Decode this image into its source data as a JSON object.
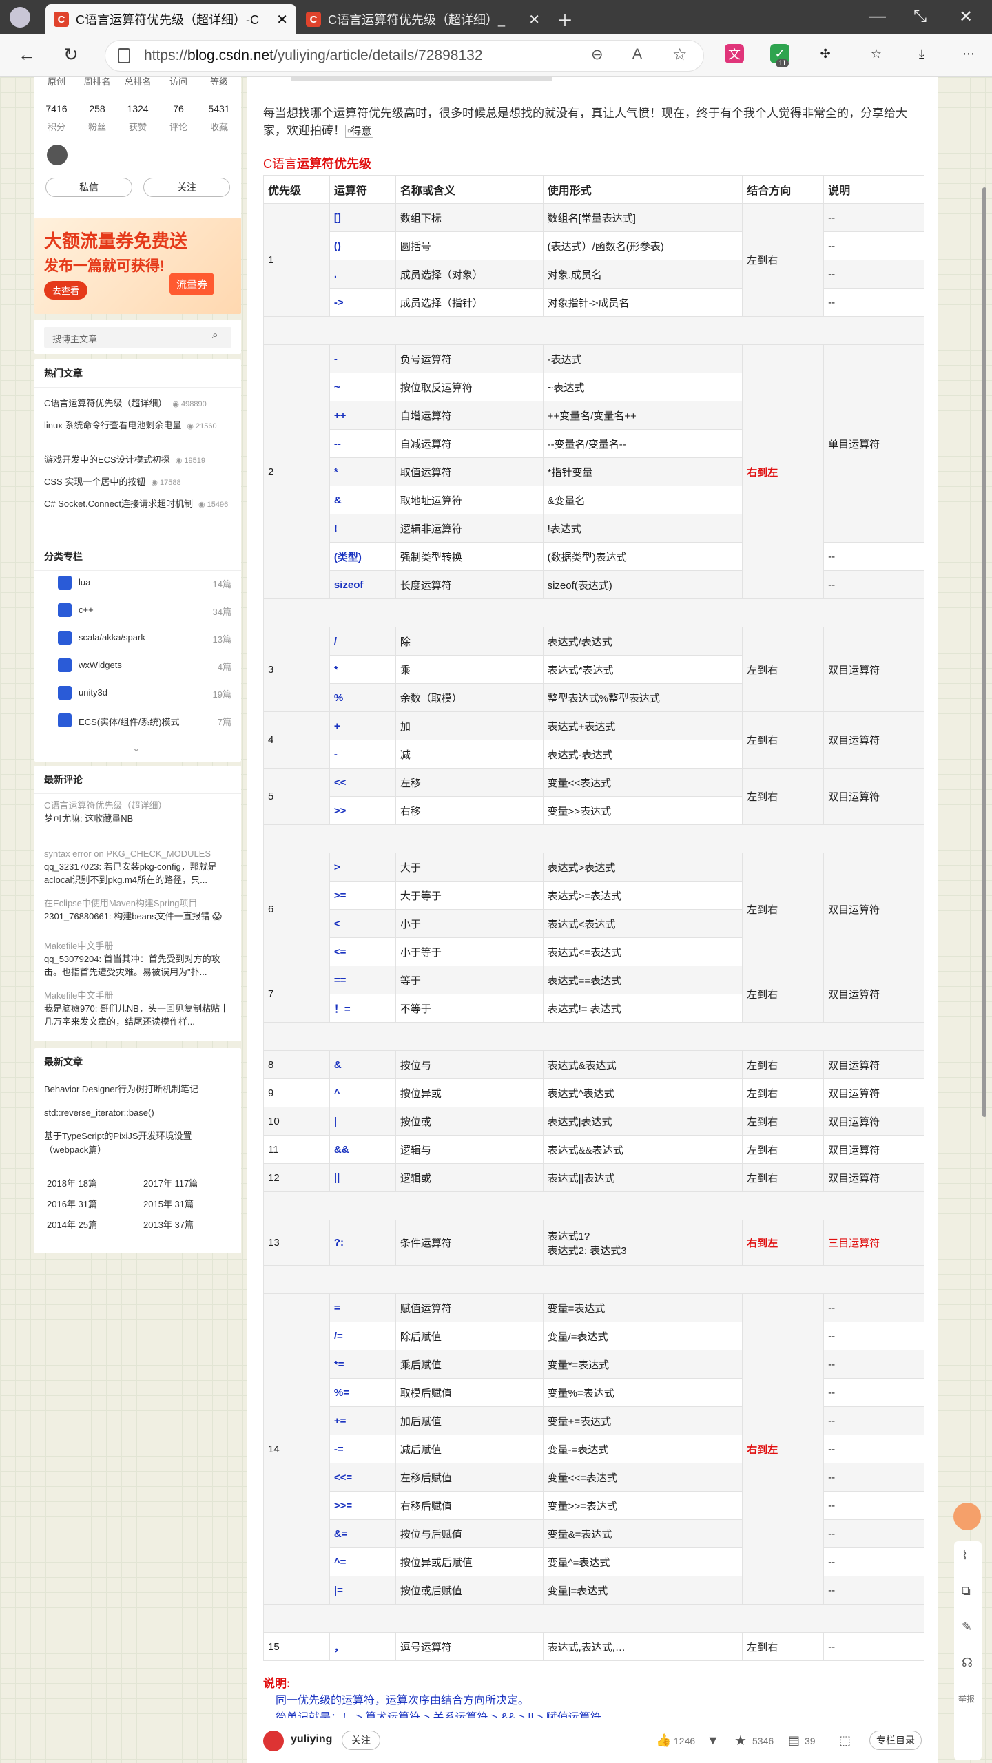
{
  "browser": {
    "tab1": "C语言运算符优先级（超详细）-C",
    "tab2": "C语言运算符优先级（超详细）_",
    "url_prefix": "https://",
    "url_domain": "blog.csdn.net",
    "url_path": "/yuliying/article/details/72898132",
    "ext_badge": "11"
  },
  "profile": {
    "labels": [
      "原创",
      "周排名",
      "总排名",
      "访问",
      "等级"
    ],
    "values": [
      "7416",
      "258",
      "1324",
      "76",
      "5431"
    ],
    "sublabels": [
      "积分",
      "粉丝",
      "获赞",
      "评论",
      "收藏"
    ],
    "msg_btn": "私信",
    "follow_btn": "关注"
  },
  "ad": {
    "line1": "大额流量券免费送",
    "line2": "发布一篇就可获得!",
    "btn": "去查看",
    "coupon": "流量券"
  },
  "search": {
    "placeholder": "搜博主文章"
  },
  "hot": {
    "title": "热门文章",
    "items": [
      {
        "t": "C语言运算符优先级（超详细）",
        "n": "498890"
      },
      {
        "t": "linux 系统命令行查看电池剩余电量",
        "n": "21560"
      },
      {
        "t": "游戏开发中的ECS设计模式初探",
        "n": "19519"
      },
      {
        "t": "CSS 实现一个居中的按钮",
        "n": "17588"
      },
      {
        "t": "C# Socket.Connect连接请求超时机制",
        "n": "15496"
      }
    ]
  },
  "cats": {
    "title": "分类专栏",
    "items": [
      {
        "t": "lua",
        "n": "14篇"
      },
      {
        "t": "c++",
        "n": "34篇"
      },
      {
        "t": "scala/akka/spark",
        "n": "13篇"
      },
      {
        "t": "wxWidgets",
        "n": "4篇"
      },
      {
        "t": "unity3d",
        "n": "19篇"
      },
      {
        "t": "ECS(实体/组件/系统)模式",
        "n": "7篇"
      }
    ]
  },
  "comments": {
    "title": "最新评论",
    "items": [
      {
        "a": "C语言运算符优先级（超详细）",
        "b": "梦可尤嘛: 这收藏量NB"
      },
      {
        "a": "syntax error on PKG_CHECK_MODULES",
        "b": "qq_32317023: 若已安装pkg-config，那就是aclocal识别不到pkg.m4所在的路径，只..."
      },
      {
        "a": "在Eclipse中使用Maven构建Spring项目",
        "b": "2301_76880661: 构建beans文件一直报错 😱"
      },
      {
        "a": "Makefile中文手册",
        "b": "qq_53079204: 首当其冲：首先受到对方的攻击。也指首先遭受灾难。易被误用为\"扑..."
      },
      {
        "a": "Makefile中文手册",
        "b": "我是脑瘫970: 哥们儿NB，头一回见复制粘贴十几万字来发文章的，结尾还读模作样..."
      }
    ]
  },
  "recent": {
    "title": "最新文章",
    "items": [
      "Behavior Designer行为树打断机制笔记",
      "std::reverse_iterator::base()",
      "基于TypeScript的PixiJS开发环境设置（webpack篇）"
    ],
    "archive": [
      "2018年 18篇",
      "2017年 117篇",
      "2016年 31篇",
      "2015年 31篇",
      "2014年 25篇",
      "2013年 37篇"
    ]
  },
  "article": {
    "intro": "每当想找哪个运算符优先级高时，很多时候总是想找的就没有，真让人气愤！现在，终于有个我个人觉得非常全的，分享给大家，欢迎拍砖！",
    "img_alt": "得意",
    "heading_a": "C语言",
    "heading_b": "运算符优先级",
    "headers": [
      "优先级",
      "运算符",
      "名称或含义",
      "使用形式",
      "结合方向",
      "说明"
    ],
    "note_title": "说明:",
    "note1": "同一优先级的运算符，运算次序由结合方向所决定。",
    "note2": "简单记就是：！ > 算术运算符 > 关系运算符 > && > || > 赋值运算符"
  },
  "rows": {
    "g1": [
      [
        "[]",
        "数组下标",
        "数组名[常量表达式]",
        "--"
      ],
      [
        "()",
        "圆括号",
        "(表达式）/函数名(形参表)",
        "--"
      ],
      [
        ".",
        "成员选择（对象）",
        "对象.成员名",
        "--"
      ],
      [
        "->",
        "成员选择（指针）",
        "对象指针->成员名",
        "--"
      ]
    ],
    "g2": [
      [
        "-",
        "负号运算符",
        "-表达式"
      ],
      [
        "~",
        "按位取反运算符",
        "~表达式"
      ],
      [
        "++",
        "自增运算符",
        "++变量名/变量名++"
      ],
      [
        "--",
        "自减运算符",
        "--变量名/变量名--"
      ],
      [
        "*",
        "取值运算符",
        "*指针变量"
      ],
      [
        "&",
        "取地址运算符",
        "&变量名"
      ],
      [
        "!",
        "逻辑非运算符",
        "!表达式"
      ],
      [
        "(类型)",
        "强制类型转换",
        "(数据类型)表达式",
        "--"
      ],
      [
        "sizeof",
        "长度运算符",
        "sizeof(表达式)",
        "--"
      ]
    ],
    "g3": [
      [
        "/",
        "除",
        "表达式/表达式"
      ],
      [
        "*",
        "乘",
        "表达式*表达式"
      ],
      [
        "%",
        "余数（取模）",
        "整型表达式%整型表达式"
      ]
    ],
    "g4": [
      [
        "+",
        "加",
        "表达式+表达式"
      ],
      [
        "-",
        "减",
        "表达式-表达式"
      ]
    ],
    "g5": [
      [
        "<<",
        "左移",
        "变量<<表达式"
      ],
      [
        ">>",
        "右移",
        "变量>>表达式"
      ]
    ],
    "g6": [
      [
        ">",
        "大于",
        "表达式>表达式"
      ],
      [
        ">=",
        "大于等于",
        "表达式>=表达式"
      ],
      [
        "<",
        "小于",
        "表达式<表达式"
      ],
      [
        "<=",
        "小于等于",
        "表达式<=表达式"
      ]
    ],
    "g7": [
      [
        "==",
        "等于",
        "表达式==表达式"
      ],
      [
        "！=",
        "不等于",
        "表达式!= 表达式"
      ]
    ],
    "single": [
      [
        "8",
        "&",
        "按位与",
        "表达式&表达式"
      ],
      [
        "9",
        "^",
        "按位异或",
        "表达式^表达式"
      ],
      [
        "10",
        "|",
        "按位或",
        "表达式|表达式"
      ],
      [
        "11",
        "&&",
        "逻辑与",
        "表达式&&表达式"
      ],
      [
        "12",
        "||",
        "逻辑或",
        "表达式||表达式"
      ]
    ],
    "g13": [
      "13",
      "?:",
      "条件运算符",
      "表达式1?",
      "表达式2: 表达式3",
      "右到左",
      "三目运算符"
    ],
    "g14": [
      [
        "=",
        "赋值运算符",
        "变量=表达式"
      ],
      [
        "/=",
        "除后赋值",
        "变量/=表达式"
      ],
      [
        "*=",
        "乘后赋值",
        "变量*=表达式"
      ],
      [
        "%=",
        "取模后赋值",
        "变量%=表达式"
      ],
      [
        "+=",
        "加后赋值",
        "变量+=表达式"
      ],
      [
        "-=",
        "减后赋值",
        "变量-=表达式"
      ],
      [
        "<<=",
        "左移后赋值",
        "变量<<=表达式"
      ],
      [
        ">>=",
        "右移后赋值",
        "变量>>=表达式"
      ],
      [
        "&=",
        "按位与后赋值",
        "变量&=表达式"
      ],
      [
        "^=",
        "按位异或后赋值",
        "变量^=表达式"
      ],
      [
        "|=",
        "按位或后赋值",
        "变量|=表达式"
      ]
    ],
    "g15": [
      "15",
      "，",
      "逗号运算符",
      "表达式,表达式,…",
      "左到右",
      "--"
    ],
    "l2r": "左到右",
    "r2l": "右到左",
    "unary": "单目运算符",
    "binary": "双目运算符",
    "dash": "--"
  },
  "footer": {
    "author": "yuliying",
    "follow": "关注",
    "likes": "1246",
    "stars": "5346",
    "comments": "39",
    "toc": "专栏目录"
  },
  "right_tools": {
    "report": "举报"
  }
}
